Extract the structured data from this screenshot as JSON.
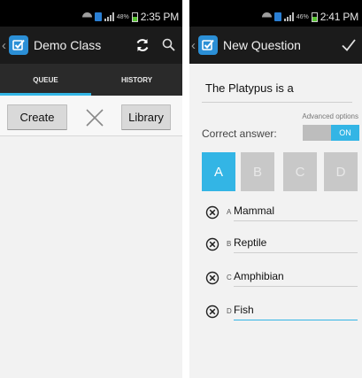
{
  "left_screen": {
    "status": {
      "battery_pct": "48%",
      "time": "2:35 PM"
    },
    "title": "Demo Class",
    "tabs": [
      {
        "label": "QUEUE"
      },
      {
        "label": "HISTORY"
      }
    ],
    "toolbar": {
      "create_label": "Create",
      "library_label": "Library"
    }
  },
  "right_screen": {
    "status": {
      "battery_pct": "46%",
      "time": "2:41 PM"
    },
    "title": "New Question",
    "question_text": "The Platypus is a",
    "advanced_options_label": "Advanced options",
    "correct_answer_label": "Correct answer:",
    "toggle_label": "ON",
    "choices": [
      {
        "letter": "A"
      },
      {
        "letter": "B"
      },
      {
        "letter": "C"
      },
      {
        "letter": "D"
      }
    ],
    "selected_choice": "A",
    "answers": [
      {
        "letter": "A",
        "text": "Mammal"
      },
      {
        "letter": "B",
        "text": "Reptile"
      },
      {
        "letter": "C",
        "text": "Amphibian"
      },
      {
        "letter": "D",
        "text": "Fish"
      }
    ]
  },
  "colors": {
    "accent": "#33b5e5",
    "logo_blue": "#2b8fd6",
    "action_bar": "#1b1b1b",
    "tab_bar": "#2a2a2a",
    "choice_inactive": "#c8c8c8"
  },
  "icons": [
    "app-logo-icon",
    "refresh-icon",
    "search-icon",
    "close-x-icon",
    "check-icon",
    "delete-circle-x-icon",
    "wifi-icon",
    "signal-icon",
    "battery-icon"
  ]
}
